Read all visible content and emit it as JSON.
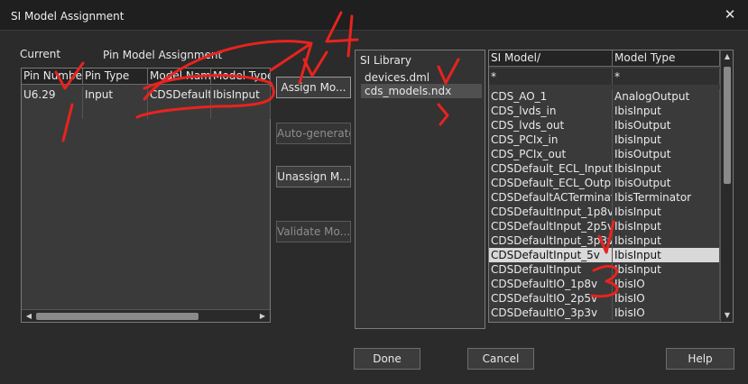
{
  "window": {
    "title": "SI Model Assignment",
    "close": "✕"
  },
  "current": {
    "label": "Current",
    "pin_label": "Pin Model Assignment",
    "columns": [
      "Pin Number",
      "Pin Type",
      "Model Name",
      "Model Type"
    ],
    "rows": [
      [
        "U6.29",
        "Input",
        "CDSDefaultI",
        "IbisInput"
      ]
    ]
  },
  "buttons": {
    "assign": "Assign Mo...",
    "auto_generate": "Auto-generate",
    "unassign": "Unassign M...",
    "validate": "Validate Mo...",
    "done": "Done",
    "cancel": "Cancel",
    "help": "Help"
  },
  "library": {
    "label": "SI Library",
    "items": [
      "devices.dml",
      "cds_models.ndx"
    ],
    "selected_index": 1
  },
  "models": {
    "columns": [
      "SI Model/",
      "Model Type"
    ],
    "filter": [
      "*",
      "*"
    ],
    "rows": [
      [
        "CDS_AO_1",
        "AnalogOutput"
      ],
      [
        "CDS_lvds_in",
        "IbisInput"
      ],
      [
        "CDS_lvds_out",
        "IbisOutput"
      ],
      [
        "CDS_PCIx_in",
        "IbisInput"
      ],
      [
        "CDS_PCIx_out",
        "IbisOutput"
      ],
      [
        "CDSDefault_ECL_Input",
        "IbisInput"
      ],
      [
        "CDSDefault_ECL_Outpu",
        "IbisOutput"
      ],
      [
        "CDSDefaultACTerminato",
        "IbisTerminator"
      ],
      [
        "CDSDefaultInput_1p8v",
        "IbisInput"
      ],
      [
        "CDSDefaultInput_2p5v",
        "IbisInput"
      ],
      [
        "CDSDefaultInput_3p3v",
        "IbisInput"
      ],
      [
        "CDSDefaultInput_5v",
        "IbisInput"
      ],
      [
        "CDSDefaultInput",
        "IbisInput"
      ],
      [
        "CDSDefaultIO_1p8v",
        "IbisIO"
      ],
      [
        "CDSDefaultIO_2p5v",
        "IbisIO"
      ],
      [
        "CDSDefaultIO_3p3v",
        "IbisIO"
      ]
    ],
    "selected_index": 11
  },
  "icons": {
    "scroll_left": "◀",
    "scroll_right": "▶",
    "scroll_up": "▲",
    "scroll_down": "▼"
  },
  "colors": {
    "annotation": "#e8231f"
  }
}
